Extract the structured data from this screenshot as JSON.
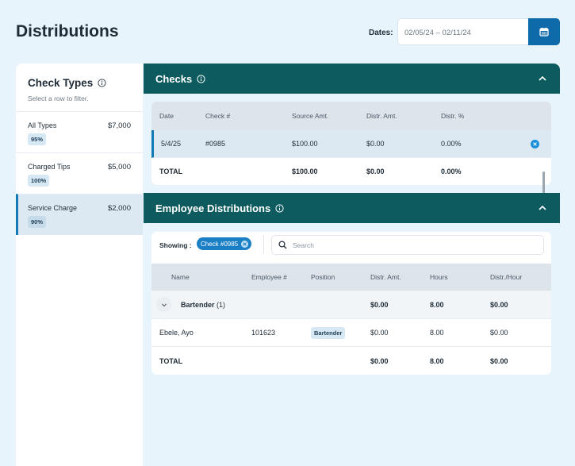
{
  "page": {
    "title": "Distributions"
  },
  "dates": {
    "label": "Dates:",
    "value": "02/05/24 – 02/11/24"
  },
  "check_types": {
    "title": "Check Types",
    "subtitle": "Select a row to filter.",
    "items": [
      {
        "name": "All Types",
        "amount": "$7,000",
        "percent": "95%"
      },
      {
        "name": "Charged Tips",
        "amount": "$5,000",
        "percent": "100%"
      },
      {
        "name": "Service Charge",
        "amount": "$2,000",
        "percent": "90%"
      }
    ]
  },
  "checks": {
    "title": "Checks",
    "columns": [
      "Date",
      "Check #",
      "Source Amt.",
      "Distr. Amt.",
      "Distr. %"
    ],
    "rows": [
      {
        "date": "5/4/25",
        "check": "#0985",
        "source": "$100.00",
        "distr": "$0.00",
        "pct": "0.00%"
      }
    ],
    "total": {
      "label": "TOTAL",
      "source": "$100.00",
      "distr": "$0.00",
      "pct": "0.00%"
    }
  },
  "employee_distributions": {
    "title": "Employee Distributions",
    "showing_label": "Showing :",
    "filter_chip": "Check #0985",
    "search_placeholder": "Search",
    "columns": [
      "Name",
      "Employee #",
      "Position",
      "Distr. Amt.",
      "Hours",
      "Distr./Hour"
    ],
    "group": {
      "name": "Bartender",
      "count": "(1)",
      "distr": "$0.00",
      "hours": "8.00",
      "per_hour": "$0.00"
    },
    "rows": [
      {
        "name": "Ebele, Ayo",
        "employee": "101623",
        "position": "Bartender",
        "distr": "$0.00",
        "hours": "8.00",
        "per_hour": "$0.00"
      }
    ],
    "total": {
      "label": "TOTAL",
      "distr": "$0.00",
      "hours": "8.00",
      "per_hour": "$0.00"
    }
  },
  "colors": {
    "header": "#0d5b5e",
    "accent": "#0e6aa8",
    "chip": "#1b7fc6",
    "page_bg": "#e8f4fb"
  }
}
